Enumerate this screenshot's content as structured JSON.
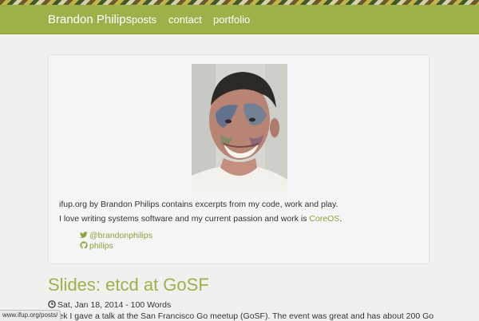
{
  "nav": {
    "brand": "Brandon Philips",
    "links": [
      "posts",
      "contact",
      "portfolio"
    ]
  },
  "profile": {
    "photo_alt": "Brandon Philips with face paint",
    "bio_line1": "ifup.org by Brandon Philips contains excerpts from my code, work and play.",
    "bio_line2_prefix": "I love writing systems software and my current passion and work is ",
    "bio_line2_link": "CoreOS",
    "bio_line2_suffix": ".",
    "twitter": "@brandonphilips",
    "github": "philips"
  },
  "post": {
    "title": "Slides: etcd at GoSF",
    "meta": "Sat, Jan 18, 2014 - 100 Words",
    "excerpt": "week I gave a talk at the San Francisco Go meetup (GoSF). The event was great and has about 200 Go"
  },
  "status_url": "www.ifup.org/posts/",
  "colors": {
    "accent": "#9db14a",
    "link": "#8aa33a",
    "background": "#f0f0ef"
  },
  "icons": {
    "twitter": "twitter-icon",
    "github": "github-icon",
    "clock": "clock-icon"
  }
}
